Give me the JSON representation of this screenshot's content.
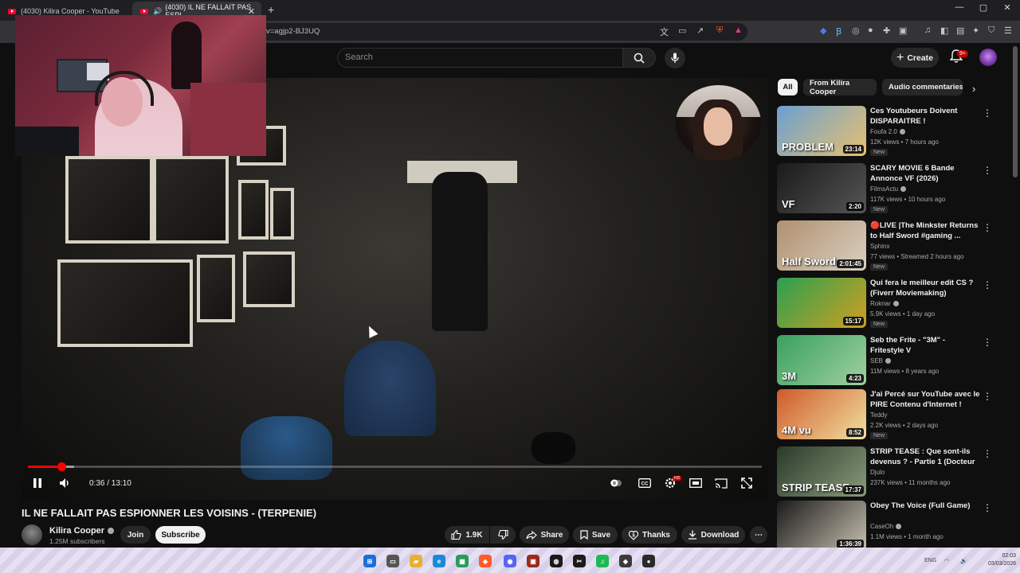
{
  "browser": {
    "tabs": [
      {
        "label": "(4030) Kilira Cooper - YouTube"
      },
      {
        "label": "(4030) IL NE FALLAIT PAS ESPI"
      }
    ],
    "url": "v=agjp2-BJ3UQ"
  },
  "header": {
    "search_placeholder": "Search",
    "create_label": "Create",
    "notifications_badge": "9+"
  },
  "player": {
    "current_time": "0:36",
    "duration": "13:10",
    "time_display": "0:36 / 13:10",
    "progress_fraction": 0.046,
    "buffer_fraction": 0.063,
    "settings_badge": "HD"
  },
  "video": {
    "title": "IL NE FALLAIT PAS ESPIONNER LES VOISINS - (TERPENIE)",
    "channel": "Kilira Cooper",
    "subscribers": "1.25M subscribers",
    "join_label": "Join",
    "subscribe_label": "Subscribe",
    "actions": {
      "likes": "1.9K",
      "share": "Share",
      "save": "Save",
      "thanks": "Thanks",
      "download": "Download"
    }
  },
  "chips": [
    "All",
    "From Kilira Cooper",
    "Audio commentaries"
  ],
  "recommendations": [
    {
      "title": "Ces Youtubeurs Doivent DISPARAITRE !",
      "channel": "Foufa 2.0",
      "verified": true,
      "meta": "12K views • 7 hours ago",
      "badge": "New",
      "duration": "23:14",
      "thumb_text": "PROBLEM"
    },
    {
      "title": "SCARY MOVIE 6 Bande Annonce VF (2026)",
      "channel": "FilmsActu",
      "verified": true,
      "meta": "117K views • 10 hours ago",
      "badge": "New",
      "duration": "2:20",
      "thumb_text": "VF"
    },
    {
      "title": "🔴LIVE |The Minkster Returns to Half Sword #gaming ...",
      "channel": "Sphinx",
      "verified": false,
      "meta": "77 views • Streamed 2 hours ago",
      "badge": "New",
      "duration": "2:01:45",
      "thumb_text": "Half Sword"
    },
    {
      "title": "Qui fera le meilleur edit CS ? (Fiverr Moviemaking)",
      "channel": "Roknar",
      "verified": true,
      "meta": "5.9K views • 1 day ago",
      "badge": "New",
      "duration": "15:17",
      "thumb_text": ""
    },
    {
      "title": "Seb the Frite - \"3M\" - Fritestyle V",
      "channel": "SEB",
      "verified": true,
      "meta": "11M views • 8 years ago",
      "badge": "",
      "duration": "4:23",
      "thumb_text": "3M"
    },
    {
      "title": "J'ai Percé sur YouTube avec le PIRE Contenu d'Internet !",
      "channel": "Teddy",
      "verified": false,
      "meta": "2.2K views • 2 days ago",
      "badge": "New",
      "duration": "8:52",
      "thumb_text": "4M vu"
    },
    {
      "title": "STRIP TEASE : Que sont-ils devenus ? - Partie 1 (Docteur ...",
      "channel": "Djulo",
      "verified": false,
      "meta": "237K views • 11 months ago",
      "badge": "",
      "duration": "17:37",
      "thumb_text": "STRIP TEASE"
    },
    {
      "title": "Obey The Voice (Full Game)",
      "channel": "CaseOh",
      "verified": true,
      "meta": "1.1M views • 1 month ago",
      "badge": "",
      "duration": "1:36:39",
      "thumb_text": ""
    }
  ],
  "taskbar": {
    "tray_lang": "ENG",
    "time": "02:03",
    "date": "03/03/2026"
  },
  "colors": {
    "accent_red": "#ff0000",
    "background": "#0f0f0f",
    "chip_bg": "#272727"
  }
}
